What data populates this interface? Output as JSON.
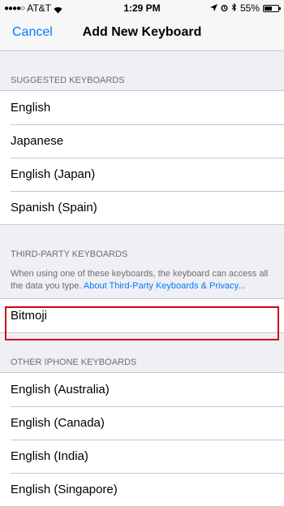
{
  "status_bar": {
    "carrier": "AT&T",
    "signal_dots": "●●●●○",
    "time": "1:29 PM",
    "battery_percent": "55%",
    "battery_level": 0.55
  },
  "nav": {
    "cancel_label": "Cancel",
    "title": "Add New Keyboard"
  },
  "sections": {
    "suggested": {
      "header": "SUGGESTED KEYBOARDS",
      "items": [
        "English",
        "Japanese",
        "English (Japan)",
        "Spanish (Spain)"
      ]
    },
    "third_party": {
      "header": "THIRD-PARTY KEYBOARDS",
      "note": "When using one of these keyboards, the keyboard can access all the data you type.",
      "link": "About Third-Party Keyboards & Privacy...",
      "items": [
        "Bitmoji"
      ]
    },
    "other": {
      "header": "OTHER IPHONE KEYBOARDS",
      "items": [
        "English (Australia)",
        "English (Canada)",
        "English (India)",
        "English (Singapore)"
      ]
    }
  },
  "colors": {
    "accent": "#007aff",
    "highlight": "#d0021b"
  }
}
